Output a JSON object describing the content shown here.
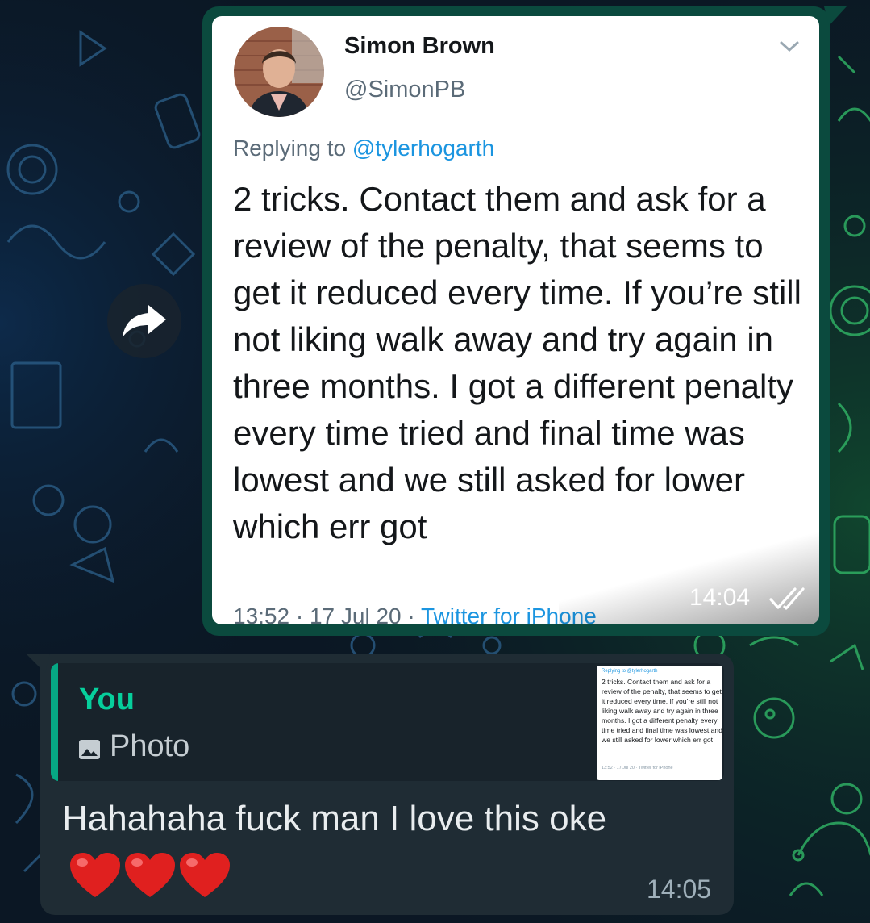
{
  "colors": {
    "outgoing_bubble": "#0b4a3e",
    "incoming_bubble": "#1f2c34",
    "quote_accent": "#06cf9c",
    "twitter_blue": "#1b95e0",
    "read_tick": "#ffffff"
  },
  "forwarded_message": {
    "forward_icon": "forward-arrow-icon",
    "tweet": {
      "author_name": "Simon Brown",
      "author_handle": "@SimonPB",
      "menu_icon": "chevron-down-icon",
      "replying_to_prefix": "Replying to ",
      "replying_to_handle": "@tylerhogarth",
      "body": "2 tricks. Contact them and ask for a review of the penalty, that seems to get it reduced every time. If you’re still not liking walk away and try again in three months. I got a different penalty every time tried and final time was lowest and we still asked for lower which err got",
      "timestamp": "13:52 · 17 Jul 20 · ",
      "source": "Twitter for iPhone"
    },
    "time": "14:04",
    "status_icon": "double-check-icon"
  },
  "reply_message": {
    "quoted": {
      "author": "You",
      "type_icon": "photo-icon",
      "type_label": "Photo",
      "thumbnail": {
        "replying_to": "Replying to @tylerhogarth",
        "body": "2 tricks. Contact them and ask for a review of the penalty, that seems to get it reduced every time. If you’re still not liking walk away and try again in three months. I got a different penalty every time tried and final time was lowest and we still asked for lower which err got",
        "meta": "13:52 · 17 Jul 20 · Twitter for iPhone"
      }
    },
    "text": "Hahahaha fuck man I love this oke",
    "emoji_icons": [
      "heart-icon",
      "heart-icon",
      "heart-icon"
    ],
    "time": "14:05"
  }
}
